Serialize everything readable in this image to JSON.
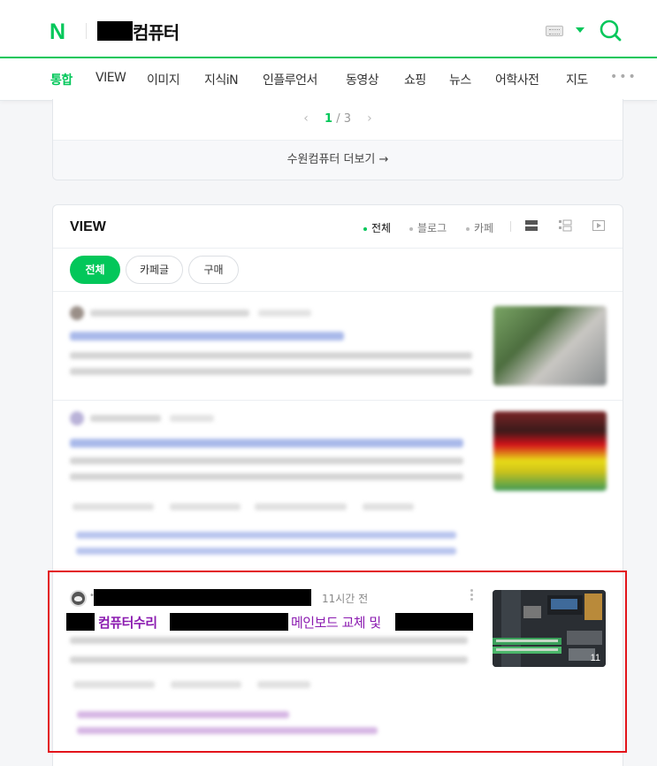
{
  "header": {
    "logo": "N",
    "query_text": "컴퓨터"
  },
  "tabs": [
    {
      "label": "통합",
      "active": true
    },
    {
      "label": "VIEW"
    },
    {
      "label": "이미지"
    },
    {
      "label": "지식iN"
    },
    {
      "label": "인플루언서"
    },
    {
      "label": "동영상"
    },
    {
      "label": "쇼핑"
    },
    {
      "label": "뉴스"
    },
    {
      "label": "어학사전"
    },
    {
      "label": "지도"
    }
  ],
  "tabs_more": "•••",
  "place": {
    "page_current": "1",
    "page_sep": "/",
    "page_total": "3",
    "more_link": "수원컴퓨터 더보기 →"
  },
  "view": {
    "title": "VIEW",
    "source_filters": [
      {
        "label": "전체",
        "active": true
      },
      {
        "label": "블로그"
      },
      {
        "label": "카페"
      }
    ],
    "chips": [
      {
        "label": "전체",
        "active": true
      },
      {
        "label": "카페글"
      },
      {
        "label": "구매"
      }
    ]
  },
  "highlighted_post": {
    "time": "11시간 전",
    "title_part1": "컴퓨터수리",
    "title_part2": "메인보드 교체 및",
    "thumb_count": "11"
  },
  "colors": {
    "brand": "#03c75a",
    "visited_link": "#8b1bb0",
    "highlight_border": "#e3141b"
  }
}
